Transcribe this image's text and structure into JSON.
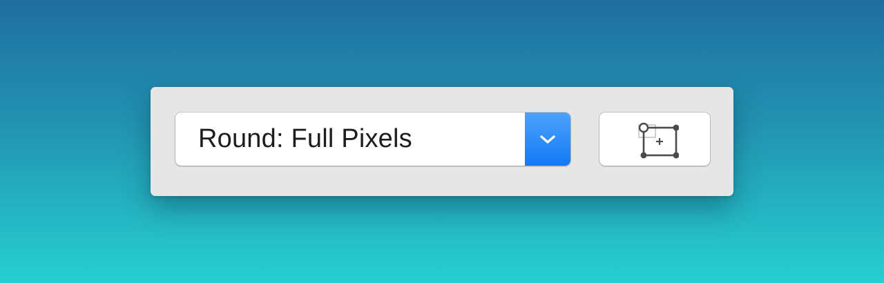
{
  "panel": {
    "rounding_select": {
      "selected_value": "Round: Full Pixels",
      "arrow_icon": "chevron-down-icon",
      "accent_color": "#1b7cf6"
    },
    "resize_button": {
      "icon": "resize-frame-icon"
    }
  },
  "colors": {
    "background_top": "#1f6ea0",
    "background_bottom": "#26d0d0",
    "panel": "#e6e6e6"
  }
}
